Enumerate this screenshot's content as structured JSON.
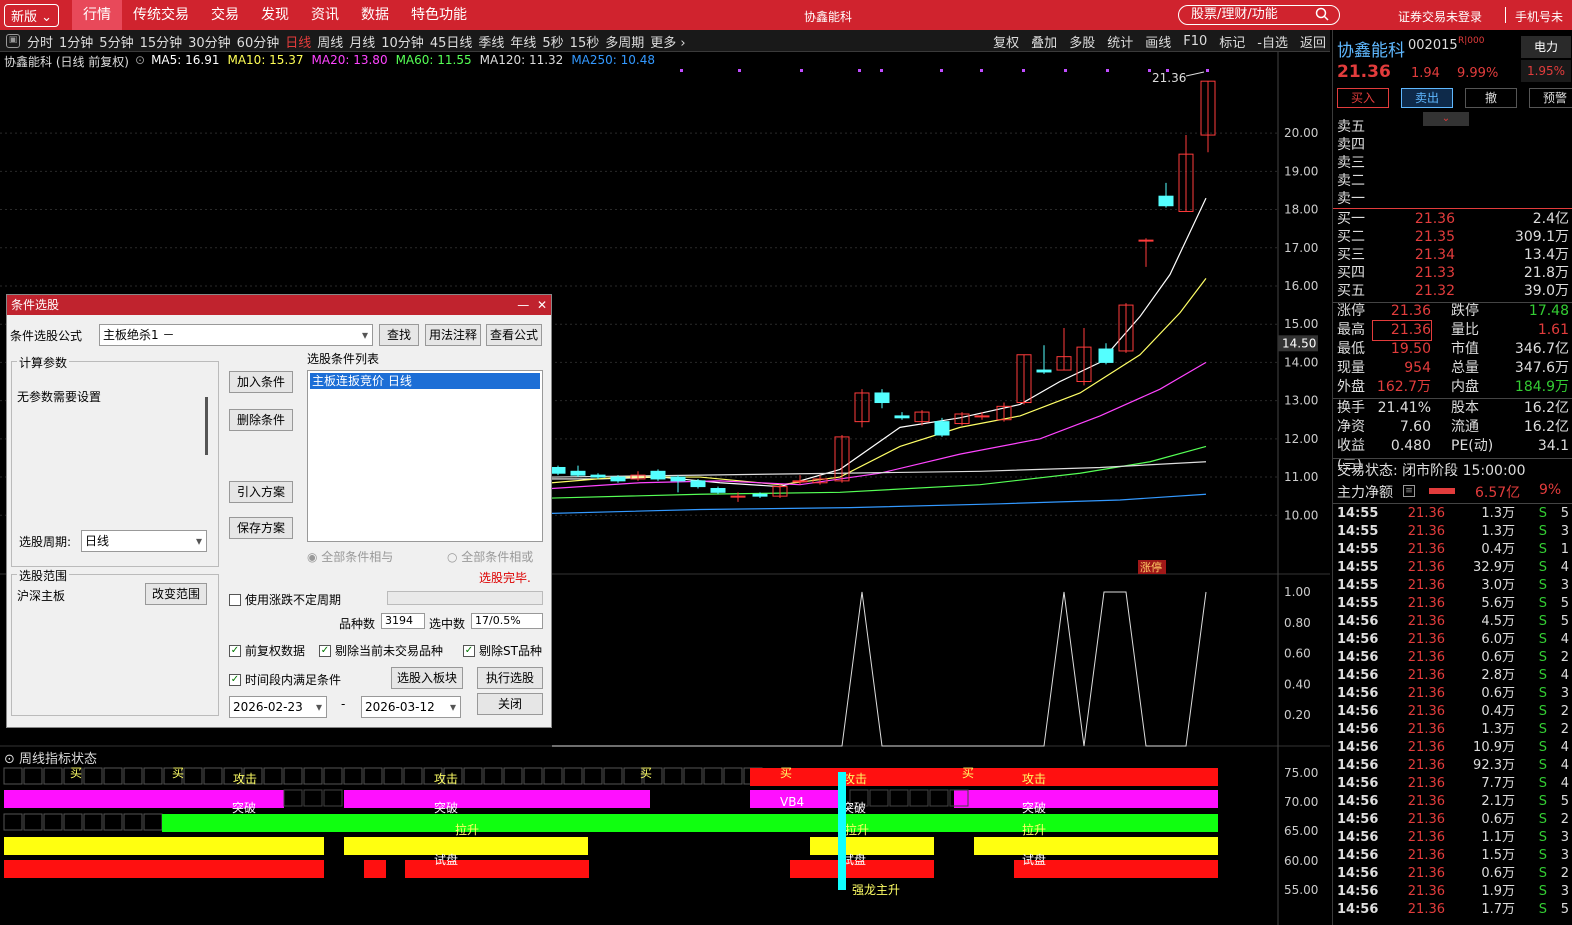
{
  "top": {
    "edition": "新版",
    "menu": [
      "行情",
      "传统交易",
      "交易",
      "发现",
      "资讯",
      "数据",
      "特色功能"
    ],
    "center_title": "协鑫能科",
    "search_placeholder": "股票/理财/功能",
    "login": "证券交易未登录",
    "mobile": "手机号未"
  },
  "periodbar": {
    "periods": [
      "分时",
      "1分钟",
      "5分钟",
      "15分钟",
      "30分钟",
      "60分钟",
      "日线",
      "周线",
      "月线",
      "10分钟",
      "45日线",
      "季线",
      "年线",
      "5秒",
      "15秒",
      "多周期",
      "更多 ›"
    ],
    "active": "日线",
    "tools": [
      "复权",
      "叠加",
      "多股",
      "统计",
      "画线",
      "F10",
      "标记",
      "-自选",
      "返回"
    ]
  },
  "chart": {
    "title": "协鑫能科 (日线 前复权)",
    "ma": [
      {
        "label": "MA5: 16.91",
        "color": "#ffffff"
      },
      {
        "label": "MA10: 15.37",
        "color": "#ffff55"
      },
      {
        "label": "MA20: 13.80",
        "color": "#ff44ff"
      },
      {
        "label": "MA60: 11.55",
        "color": "#55ff55"
      },
      {
        "label": "MA120: 11.32",
        "color": "#dddddd"
      },
      {
        "label": "MA250: 10.48",
        "color": "#3399ff"
      }
    ],
    "price_axis": [
      "20.00",
      "19.00",
      "18.00",
      "17.00",
      "16.00",
      "15.00",
      "14.00",
      "13.00",
      "12.00",
      "11.00",
      "10.00"
    ],
    "crosshair_price": "14.50",
    "high_label": "21.36",
    "zt_label": "涨停",
    "osc_axis": [
      "1.00",
      "0.80",
      "0.60",
      "0.40",
      "0.20"
    ],
    "ind_title": "周线指标状态",
    "ind_axis": [
      "75.00",
      "70.00",
      "65.00",
      "60.00",
      "55.00"
    ],
    "band_labels": {
      "buy": "买",
      "attack": "攻击",
      "break": "突破",
      "vb4": "VB4",
      "pull": "拉升",
      "trial": "试盘",
      "dragon": "强龙主升"
    }
  },
  "dialog": {
    "title": "条件选股",
    "formula_label": "条件选股公式",
    "formula_value": "主板绝杀1  －",
    "find": "查找",
    "usage": "用法注释",
    "view": "查看公式",
    "calc_params": "计算参数",
    "no_params": "无参数需要设置",
    "add": "加入条件",
    "del": "删除条件",
    "import": "引入方案",
    "save": "保存方案",
    "list_title": "选股条件列表",
    "list_item": "主板连扳竞价  日线",
    "and": "全部条件相与",
    "or": "全部条件相或",
    "done": "选股完毕.",
    "period_label": "选股周期:",
    "period_value": "日线",
    "range_title": "选股范围",
    "range_value": "沪深主板",
    "change_range": "改变范围",
    "use_var": "使用涨跌不定周期",
    "count_label": "品种数",
    "count_value": "3194",
    "sel_label": "选中数",
    "sel_value": "17/0.5%",
    "opt1": "前复权数据",
    "opt2": "剔除当前未交易品种",
    "opt3": "剔除ST品种",
    "opt4": "时间段内满足条件",
    "to_block": "选股入板块",
    "exec": "执行选股",
    "date_from": "2026-02-23",
    "date_to": "2026-03-12",
    "dash": "-",
    "close": "关闭"
  },
  "quote": {
    "name": "协鑫能科",
    "code": "002015",
    "badge": "R|000",
    "power": "电力",
    "power_pct": "1.95%",
    "price": "21.36",
    "chg": "1.94",
    "chgp": "9.99%",
    "buy": "买入",
    "sell": "卖出",
    "cancel": "撤",
    "alert": "预警",
    "asks": [
      {
        "l": "卖五",
        "p": "",
        "v": ""
      },
      {
        "l": "卖四",
        "p": "",
        "v": ""
      },
      {
        "l": "卖三",
        "p": "",
        "v": ""
      },
      {
        "l": "卖二",
        "p": "",
        "v": ""
      },
      {
        "l": "卖一",
        "p": "",
        "v": ""
      }
    ],
    "bids": [
      {
        "l": "买一",
        "p": "21.36",
        "v": "2.4亿"
      },
      {
        "l": "买二",
        "p": "21.35",
        "v": "309.1万"
      },
      {
        "l": "买三",
        "p": "21.34",
        "v": "13.4万"
      },
      {
        "l": "买四",
        "p": "21.33",
        "v": "21.8万"
      },
      {
        "l": "买五",
        "p": "21.32",
        "v": "39.0万"
      }
    ],
    "stats1": [
      [
        "涨停",
        "21.36",
        "#e23c3c",
        "跌停",
        "17.48",
        "#3c3"
      ],
      [
        "最高",
        "21.36",
        "#e23c3c",
        "量比",
        "1.61",
        "#e23c3c"
      ],
      [
        "最低",
        "19.50",
        "#e23c3c",
        "市值",
        "346.7亿",
        "#ddd"
      ],
      [
        "现量",
        "954",
        "#e23c3c",
        "总量",
        "347.6万",
        "#ddd"
      ],
      [
        "外盘",
        "162.7万",
        "#e23c3c",
        "内盘",
        "184.9万",
        "#3c3"
      ]
    ],
    "stats2": [
      [
        "换手",
        "21.41%",
        "#ddd",
        "股本",
        "16.2亿",
        "#ddd"
      ],
      [
        "净资",
        "7.60",
        "#ddd",
        "流通",
        "16.2亿",
        "#ddd"
      ],
      [
        "收益(三)",
        "0.480",
        "#ddd",
        "PE(动)",
        "34.1",
        "#ddd"
      ]
    ],
    "trade_state": "交易状态: 闭市阶段 15:00:00",
    "main_flow_label": "主力净额",
    "main_flow": "6.57亿",
    "main_flow_pct": "9%",
    "ticks": [
      [
        "14:55",
        "21.36",
        "1.3万",
        "S",
        "5"
      ],
      [
        "14:55",
        "21.36",
        "1.3万",
        "S",
        "3"
      ],
      [
        "14:55",
        "21.36",
        "0.4万",
        "S",
        "1"
      ],
      [
        "14:55",
        "21.36",
        "32.9万",
        "S",
        "4"
      ],
      [
        "14:55",
        "21.36",
        "3.0万",
        "S",
        "3"
      ],
      [
        "14:55",
        "21.36",
        "5.6万",
        "S",
        "5"
      ],
      [
        "14:56",
        "21.36",
        "4.5万",
        "S",
        "5"
      ],
      [
        "14:56",
        "21.36",
        "6.0万",
        "S",
        "4"
      ],
      [
        "14:56",
        "21.36",
        "0.6万",
        "S",
        "2"
      ],
      [
        "14:56",
        "21.36",
        "2.8万",
        "S",
        "4"
      ],
      [
        "14:56",
        "21.36",
        "0.6万",
        "S",
        "3"
      ],
      [
        "14:56",
        "21.36",
        "0.4万",
        "S",
        "2"
      ],
      [
        "14:56",
        "21.36",
        "1.3万",
        "S",
        "2"
      ],
      [
        "14:56",
        "21.36",
        "10.9万",
        "S",
        "4"
      ],
      [
        "14:56",
        "21.36",
        "92.3万",
        "S",
        "4"
      ],
      [
        "14:56",
        "21.36",
        "7.7万",
        "S",
        "4"
      ],
      [
        "14:56",
        "21.36",
        "2.1万",
        "S",
        "5"
      ],
      [
        "14:56",
        "21.36",
        "0.6万",
        "S",
        "2"
      ],
      [
        "14:56",
        "21.36",
        "1.1万",
        "S",
        "3"
      ],
      [
        "14:56",
        "21.36",
        "1.5万",
        "S",
        "3"
      ],
      [
        "14:56",
        "21.36",
        "0.6万",
        "S",
        "2"
      ],
      [
        "14:56",
        "21.36",
        "1.9万",
        "S",
        "3"
      ],
      [
        "14:56",
        "21.36",
        "1.7万",
        "S",
        "5"
      ]
    ]
  }
}
